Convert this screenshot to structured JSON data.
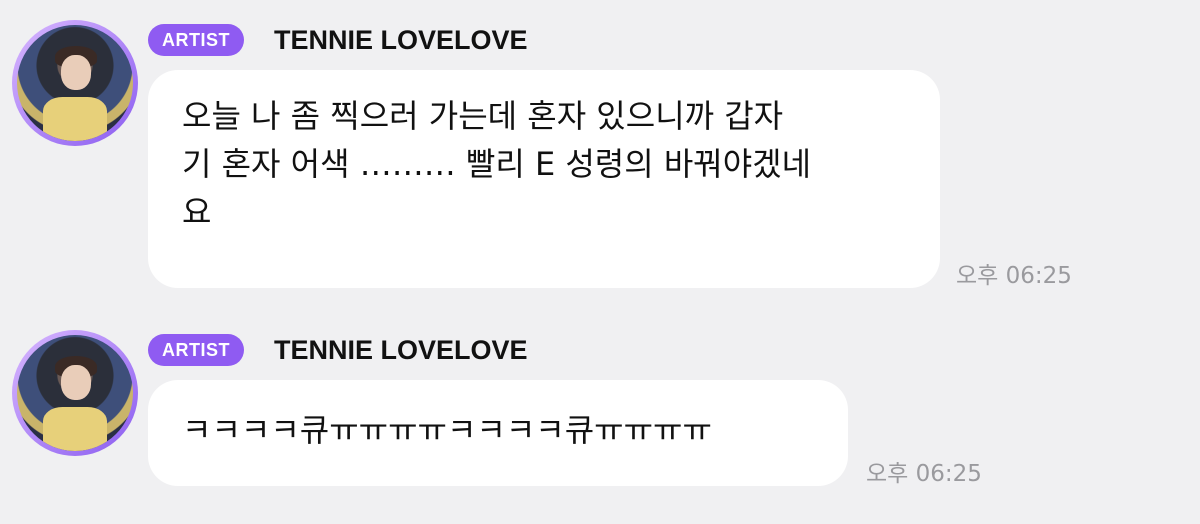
{
  "messages": [
    {
      "badge": "ARTIST",
      "sender": "TENNIE LOVELOVE",
      "lines": [
        "오늘 나 좀 찍으러 가는데 혼자 있으니까 갑자",
        "기 혼자 어색 ……… 빨리 E 성령의 바꿔야겠네",
        "요"
      ],
      "time": "오후 06:25"
    },
    {
      "badge": "ARTIST",
      "sender": "TENNIE LOVELOVE",
      "lines": [
        "ㅋㅋㅋㅋ큐ㅠㅠㅠㅠㅋㅋㅋㅋ큐ㅠㅠㅠㅠ"
      ],
      "time": "오후 06:25"
    }
  ],
  "colors": {
    "background": "#f0f0f2",
    "badge": "#8f5bf2",
    "bubble": "#ffffff",
    "time": "#9a9a9e"
  },
  "icons": {
    "avatar": "artist-profile-photo"
  }
}
